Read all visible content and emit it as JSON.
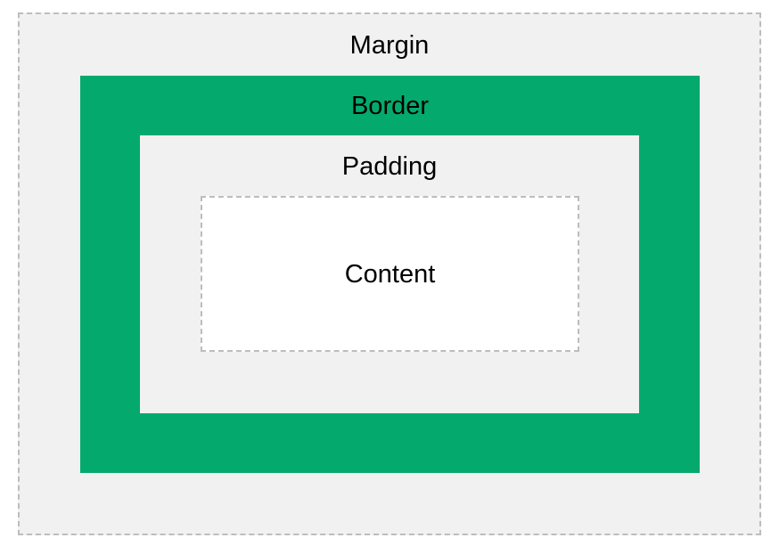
{
  "diagram": {
    "margin": {
      "label": "Margin",
      "fill": "#f1f1f1",
      "outline": "#bdbdbd"
    },
    "border": {
      "label": "Border",
      "fill": "#04aa6d"
    },
    "padding": {
      "label": "Padding",
      "fill": "#f1f1f1"
    },
    "content": {
      "label": "Content",
      "fill": "#ffffff",
      "outline": "#bdbdbd"
    }
  }
}
